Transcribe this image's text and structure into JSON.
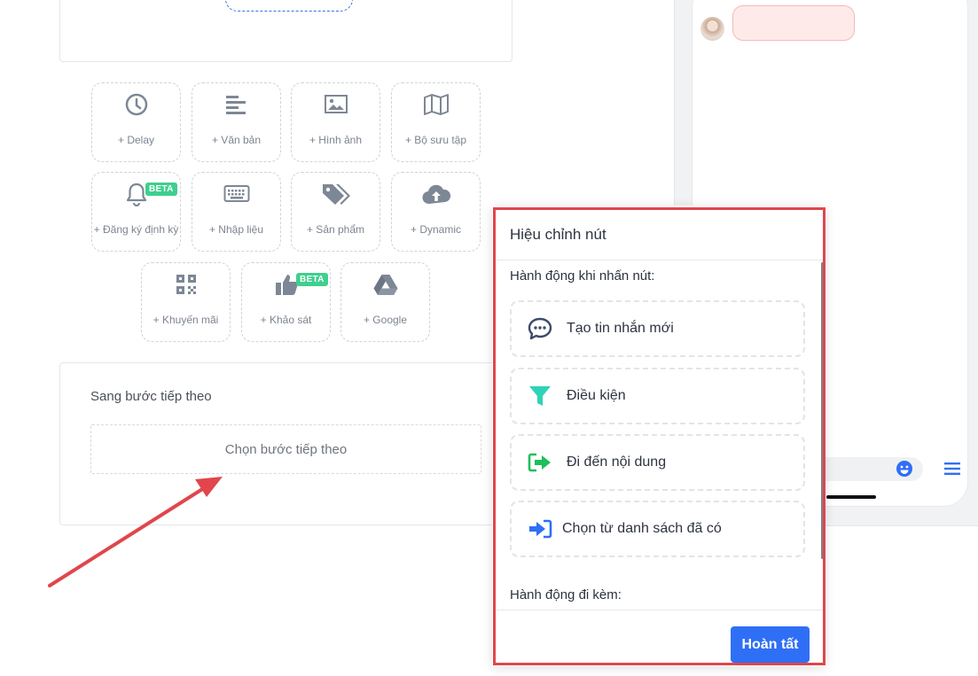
{
  "tiles": [
    {
      "label": "+ Delay",
      "icon": "clock-icon"
    },
    {
      "label": "+ Văn bản",
      "icon": "text-lines-icon"
    },
    {
      "label": "+ Hình ảnh",
      "icon": "image-icon"
    },
    {
      "label": "+ Bộ sưu tập",
      "icon": "map-gallery-icon"
    },
    {
      "label": "+ Đăng ký định kỳ",
      "icon": "bell-icon",
      "badge": "BETA"
    },
    {
      "label": "+ Nhập liệu",
      "icon": "keyboard-icon"
    },
    {
      "label": "+ Sản phẩm",
      "icon": "tags-icon"
    },
    {
      "label": "+ Dynamic",
      "icon": "cloud-upload-icon"
    },
    {
      "label": "+ Khuyến mãi",
      "icon": "qr-code-icon"
    },
    {
      "label": "+ Khảo sát",
      "icon": "thumbs-up-icon",
      "badge": "BETA"
    },
    {
      "label": "+ Google",
      "icon": "google-drive-icon"
    }
  ],
  "next_step": {
    "title": "Sang bước tiếp theo",
    "select_placeholder": "Chọn bước tiếp theo"
  },
  "modal": {
    "title": "Hiệu chỉnh nút",
    "click_action_label": "Hành động khi nhấn nút:",
    "actions": [
      {
        "label": "Tạo tin nhắn mới",
        "icon": "chat-bubble-icon",
        "color": "#3b4a6b"
      },
      {
        "label": "Điều kiện",
        "icon": "filter-icon",
        "color": "#2ed3b7"
      },
      {
        "label": "Đi đến nội dung",
        "icon": "arrow-exit-icon",
        "color": "#1fbf5a"
      },
      {
        "label": "Chọn từ danh sách đã có",
        "icon": "sign-in-arrow-icon",
        "color": "#2f6ff5"
      }
    ],
    "attached_action_label": "Hành động đi kèm:",
    "done_label": "Hoàn tất"
  },
  "colors": {
    "accent": "#2f6ff5",
    "highlight_frame": "#e0464c",
    "beta_badge": "#3fcf8e"
  }
}
